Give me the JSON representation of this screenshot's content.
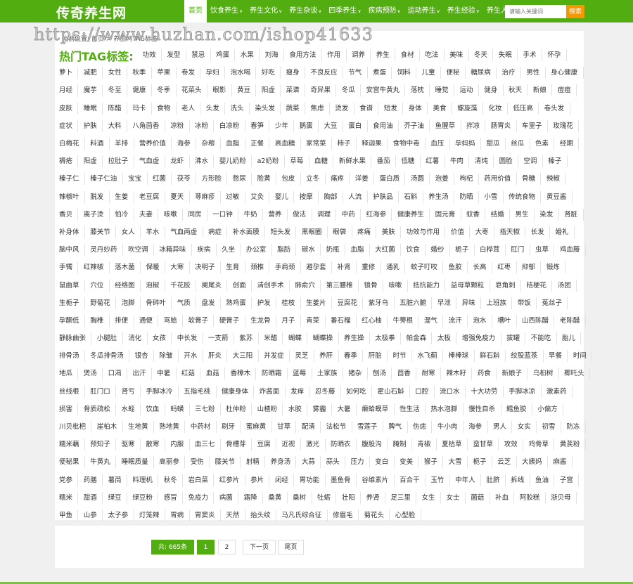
{
  "header": {
    "logo": "传奇养生网",
    "nav": [
      {
        "label": "首页",
        "active": true,
        "arrow": false
      },
      {
        "label": "饮食养生",
        "arrow": true
      },
      {
        "label": "养生文化",
        "arrow": true
      },
      {
        "label": "养生杂谈",
        "arrow": true
      },
      {
        "label": "四季养生",
        "arrow": true
      },
      {
        "label": "疾病预防",
        "arrow": true
      },
      {
        "label": "运动养生",
        "arrow": true
      },
      {
        "label": "养生经验",
        "arrow": true
      },
      {
        "label": "养生人群",
        "arrow": true
      }
    ],
    "search_placeholder": "请输入关键词",
    "search_button": "搜索"
  },
  "watermark": "https://www.huzhan.com/ishop41633",
  "breadcrumb": {
    "prefix": "当前位置:",
    "home": "首页",
    "sep": ">",
    "current": "养生网TAG标签"
  },
  "tags_title": "热门TAG标签:",
  "tag_rows": [
    [
      "功效",
      "发型",
      "禁忌",
      "鸡蛋",
      "水果",
      "刘海",
      "食用方法",
      "作用",
      "调养",
      "养生",
      "食材",
      "吃法",
      "美味",
      "冬天",
      "失眠",
      "手术",
      "怀孕"
    ],
    [
      "萝卜",
      "减肥",
      "女性",
      "秋季",
      "苹果",
      "卷发",
      "孕妇",
      "泡水喝",
      "好吃",
      "瘦身",
      "不良反应",
      "节气",
      "煮蛋",
      "饲料",
      "儿童",
      "便秘",
      "糖尿病",
      "治疗",
      "男性",
      "身心健康"
    ],
    [
      "月经",
      "魔芋",
      "冬至",
      "健康",
      "冬季",
      "花菜头",
      "眼影",
      "黄豆",
      "阳虚",
      "菜谱",
      "奇异果",
      "冬瓜",
      "安宫牛黄丸",
      "落枕",
      "睡觉",
      "运动",
      "健身",
      "秋天",
      "新娘",
      "痘痘"
    ],
    [
      "皮肤",
      "睡眠",
      "陈醋",
      "玛卡",
      "食物",
      "老人",
      "头发",
      "洗头",
      "染头发",
      "蔬菜",
      "焦虑",
      "烫发",
      "食谱",
      "短发",
      "身体",
      "美食",
      "螺旋藻",
      "化妆",
      "低压高",
      "卷头发"
    ],
    [
      "症状",
      "护肤",
      "大料",
      "八角茴香",
      "凉粉",
      "冰粉",
      "白凉粉",
      "春笋",
      "少年",
      "鹅蛋",
      "大豆",
      "蛋白",
      "食用油",
      "芥子油",
      "鱼腥草",
      "拌凉",
      "肠胃炎",
      "车里子",
      "玫瑰花"
    ],
    [
      "白梅花",
      "料酒",
      "羊排",
      "营养价值",
      "海参",
      "杂粮",
      "血脂",
      "正餐",
      "高血糖",
      "家常菜",
      "柿子",
      "释迦果",
      "食物中毒",
      "血压",
      "孕妈妈",
      "甜瓜",
      "丝瓜",
      "色素",
      "经期"
    ],
    [
      "褥疮",
      "阳虚",
      "拉肚子",
      "气血虚",
      "龙虾",
      "沸水",
      "婴儿奶粉",
      "a2奶粉",
      "草莓",
      "血糖",
      "新鲜水果",
      "番茄",
      "低糖",
      "红薯",
      "牛肉",
      "清炖",
      "圆脸",
      "空调",
      "榛子"
    ],
    [
      "榛子仁",
      "榛子仁油",
      "宝宝",
      "红菌",
      "茯苓",
      "方形脸",
      "憋尿",
      "脸黄",
      "包皮",
      "立冬",
      "痛疼",
      "洋姜",
      "蛋白质",
      "汤圆",
      "泡姜",
      "枸杞",
      "药用价值",
      "骨糖",
      "辣椒"
    ],
    [
      "辣椒叶",
      "脱发",
      "生姜",
      "老豆腐",
      "夏天",
      "荨麻疹",
      "过敏",
      "艾灸",
      "婴儿",
      "按摩",
      "胸部",
      "人流",
      "护肤品",
      "石斛",
      "养生汤",
      "防晒",
      "小雪",
      "传统食物",
      "黄豆酱"
    ],
    [
      "香贝",
      "离子烫",
      "怕冷",
      "夫妻",
      "咳嗽",
      "同房",
      "一口钟",
      "牛奶",
      "营养",
      "做法",
      "调理",
      "中药",
      "红海参",
      "健康养生",
      "固元膏",
      "蚊香",
      "结婚",
      "男生",
      "染发",
      "肾脏"
    ],
    [
      "补身体",
      "膝关节",
      "女人",
      "羊水",
      "气血两虚",
      "病症",
      "补水面膜",
      "短头发",
      "黑眼圈",
      "眼袋",
      "疼痛",
      "美肤",
      "功效与作用",
      "价值",
      "大枣",
      "指天椒",
      "长发",
      "婚礼"
    ],
    [
      "脑中风",
      "灵丹妙药",
      "吹空调",
      "冰箱异味",
      "疾病",
      "久坐",
      "办公室",
      "脂肪",
      "碳水",
      "奶瓶",
      "血脂",
      "大红菌",
      "饮食",
      "婚纱",
      "栀子",
      "白桦茸",
      "肛门",
      "虫草",
      "鸡血藤"
    ],
    [
      "手镯",
      "红辣椒",
      "落木菌",
      "保暖",
      "大寒",
      "决明子",
      "生育",
      "颈椎",
      "手肩颈",
      "避孕套",
      "补肾",
      "重修",
      "通乳",
      "蚊子叮咬",
      "鱼胶",
      "长高",
      "红枣",
      "抑郁",
      "锻炼"
    ],
    [
      "鼠曲草",
      "穴位",
      "经络图",
      "泡椒",
      "千花胶",
      "阑尾炎",
      "创面",
      "清创手术",
      "肺俞穴",
      "第三腰椎",
      "锁骨",
      "咳嗽",
      "抵抗能力",
      "益母草颗粒",
      "皂角刺",
      "桔梗花",
      "汤团"
    ],
    [
      "生栀子",
      "野菊花",
      "泡脚",
      "骨碎叶",
      "气质",
      "盘发",
      "熟鸡蛋",
      "护发",
      "桂枝",
      "生姜片",
      "豆腐花",
      "紫牙乌",
      "五脏六腑",
      "早泄",
      "异味",
      "上班族",
      "带饭",
      "菟丝子"
    ],
    [
      "孕酮低",
      "胸椎",
      "排便",
      "通便",
      "骂蛤",
      "软膏子",
      "硬膏子",
      "生龙骨",
      "月子",
      "青菜",
      "番石榴",
      "红心柚",
      "牛蒡根",
      "湿气",
      "流汗",
      "泡水",
      "槽叶",
      "山西陈醋",
      "老陈醋"
    ],
    [
      "静脉曲张",
      "小腿肚",
      "消化",
      "女孩",
      "中长发",
      "一支箭",
      "紫苏",
      "米醋",
      "蝴蝶",
      "蝴蝶操",
      "养生操",
      "太极拳",
      "帕金森",
      "太极",
      "增强免疫力",
      "拔罐",
      "不能吃",
      "胎儿"
    ],
    [
      "排骨汤",
      "冬瓜排骨汤",
      "银杏",
      "除皱",
      "开水",
      "肝炎",
      "大三阳",
      "并发症",
      "灵芝",
      "养肝",
      "春季",
      "肝脏",
      "时节",
      "水飞蓟",
      "棒棒球",
      "鲜石斛",
      "绞股蓝茶",
      "早餐",
      "时间"
    ],
    [
      "地瓜",
      "煲汤",
      "口渴",
      "出汗",
      "中暑",
      "红菇",
      "血菇",
      "香樟木",
      "防晒霜",
      "蓝莓",
      "土家族",
      "猪杂",
      "刨汤",
      "茴香",
      "耐寒",
      "辣木籽",
      "药食",
      "新娘子",
      "乌桕树",
      "椰吒头"
    ],
    [
      "丝线根",
      "肛门口",
      "肾亏",
      "手脚冰冷",
      "五指毛桃",
      "健康身体",
      "炸酱面",
      "发痒",
      "忍冬藤",
      "如何吃",
      "霍山石斛",
      "口腔",
      "流口水",
      "十大功劳",
      "手脚冰凉",
      "激素药"
    ],
    [
      "损害",
      "骨质疏松",
      "水蛭",
      "饮血",
      "蚂蟥",
      "三七粉",
      "杜仲粉",
      "山楂粉",
      "水胶",
      "雾霾",
      "大暑",
      "癞蛤蟆草",
      "性生活",
      "热水泡脚",
      "慢性自杀",
      "鳕鱼胶",
      "小偏方"
    ],
    [
      "川贝枇杷",
      "崖柏木",
      "生地黄",
      "熟地黄",
      "中药材",
      "刷牙",
      "蜜麻黄",
      "甘草",
      "配清",
      "法松节",
      "雪莲子",
      "脾气",
      "伤痣",
      "牛小肉",
      "海参",
      "男人",
      "女实",
      "初雪",
      "防冻"
    ],
    [
      "糯米藕",
      "预知子",
      "驱寒",
      "散寒",
      "内服",
      "血三七",
      "骨槽芽",
      "豆腐",
      "近视",
      "激光",
      "防晒衣",
      "腹股沟",
      "腌制",
      "青椒",
      "夏枯草",
      "蛮甘草",
      "攻效",
      "鸡骨草",
      "黄芪粉"
    ],
    [
      "便秘果",
      "牛黄丸",
      "睡眠质量",
      "高丽参",
      "受伤",
      "膝关节",
      "射精",
      "养身汤",
      "大蒜",
      "蒜头",
      "压力",
      "变白",
      "变美",
      "猴子",
      "大雪",
      "栀子",
      "云芝",
      "大姨妈",
      "麻酱"
    ],
    [
      "党参",
      "药膳",
      "薯茼",
      "料理机",
      "秋冬",
      "岩白菜",
      "红参片",
      "参片",
      "闭经",
      "胃功能",
      "墨鱼骨",
      "谷维素片",
      "百合干",
      "玉竹",
      "中年人",
      "肚脐",
      "拆线",
      "鱼油",
      "子宫"
    ],
    [
      "糯米",
      "甜酒",
      "绿豆",
      "绿豆粉",
      "感冒",
      "免疫力",
      "病菌",
      "霜降",
      "桑黄",
      "桑树",
      "牡蛎",
      "壮阳",
      "养肾",
      "足三里",
      "女生",
      "女士",
      "菌菇",
      "补血",
      "阿胶糕",
      "浙贝母"
    ],
    [
      "甲鱼",
      "山参",
      "太子参",
      "灯笼辣",
      "胃病",
      "胃窦炎",
      "天然",
      "抬头纹",
      "马凡氏综合征",
      "修眉毛",
      "菊花头",
      "心型脸"
    ]
  ],
  "pagination": {
    "total": "共: 665条",
    "pages": [
      "1",
      "2"
    ],
    "current": "1",
    "next": "下一页",
    "last": "尾页"
  },
  "colors": {
    "brand": "#52ad10",
    "search_button": "#f39800"
  }
}
